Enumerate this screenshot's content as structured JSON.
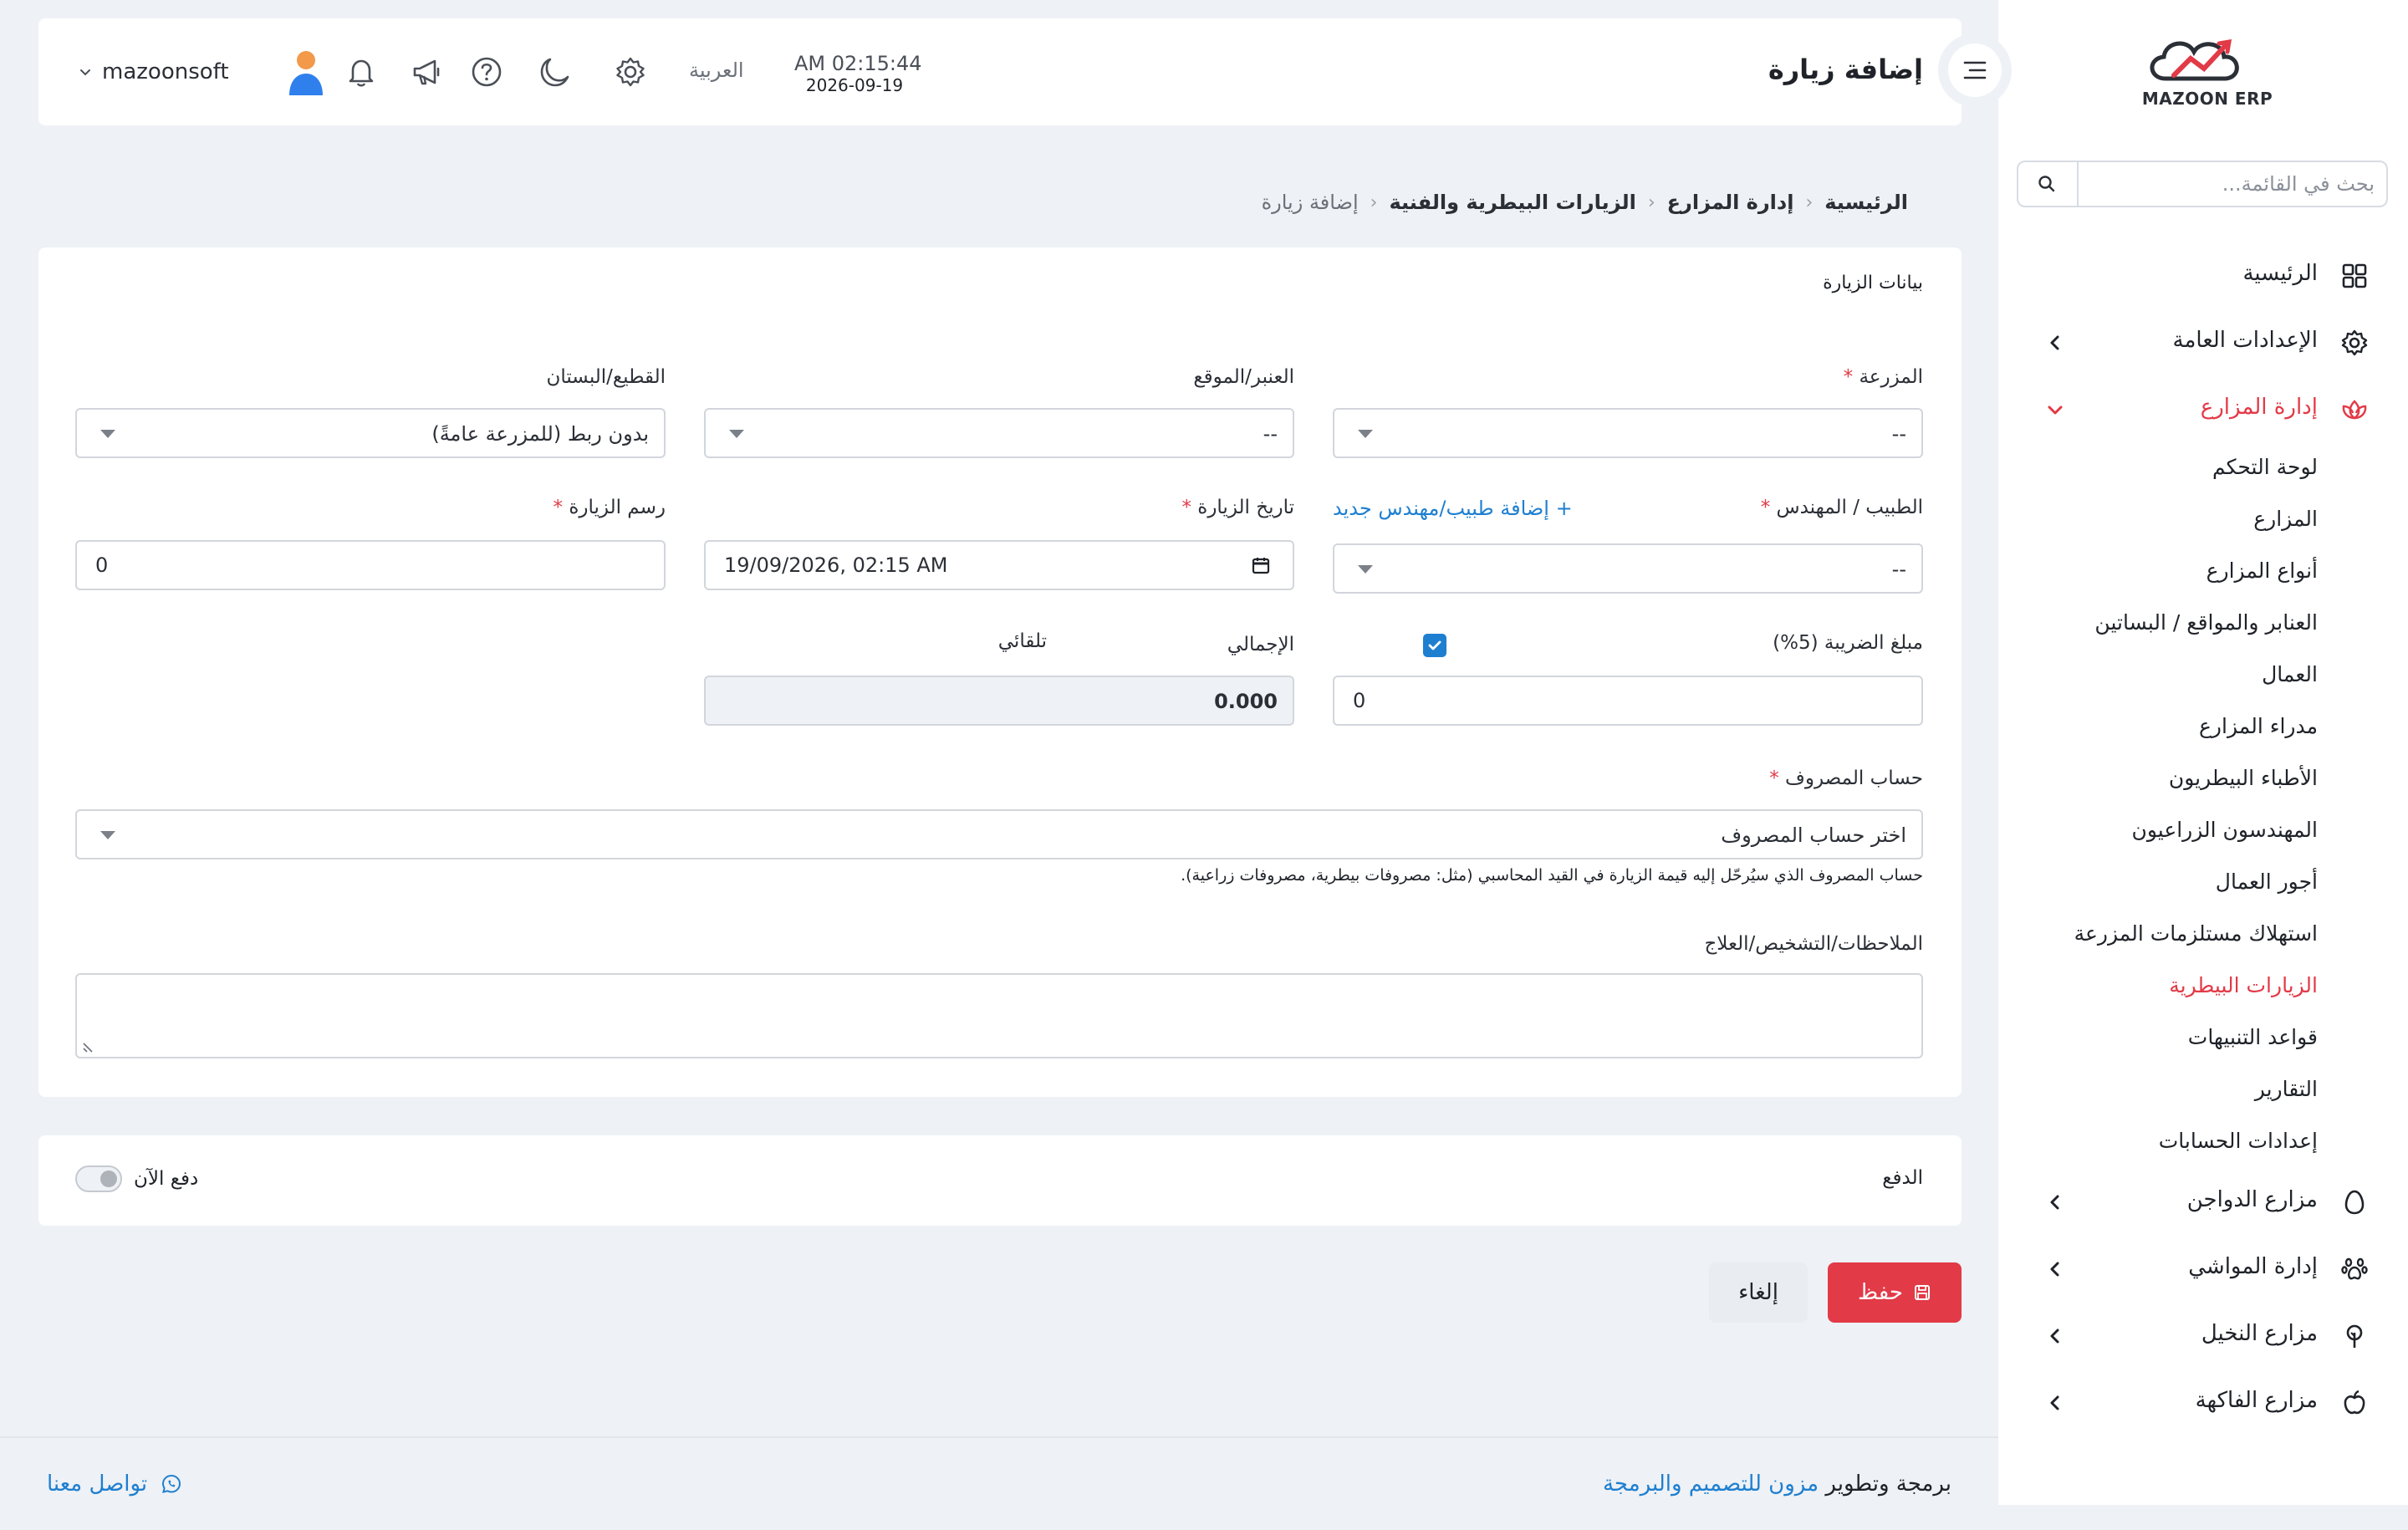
{
  "brand": {
    "logo_text": "MAZOON ERP",
    "accent": "#e23a47",
    "link_color": "#1e7fd0"
  },
  "sidebar": {
    "search_placeholder": "بحث في القائمة...",
    "items": [
      {
        "label": "الرئيسية",
        "icon": "grid-icon"
      },
      {
        "label": "الإعدادات العامة",
        "icon": "gear-icon"
      },
      {
        "label": "إدارة المزارع",
        "icon": "lotus-icon"
      },
      {
        "label": "مزارع الدواجن",
        "icon": "egg-icon"
      },
      {
        "label": "إدارة المواشي",
        "icon": "paw-icon"
      },
      {
        "label": "مزارع النخيل",
        "icon": "tree-icon"
      },
      {
        "label": "مزارع الفاكهة",
        "icon": "apple-icon"
      }
    ],
    "sub_items": [
      "لوحة التحكم",
      "المزارع",
      "أنواع المزارع",
      "العنابر والمواقع / البساتين",
      "العمال",
      "مدراء المزارع",
      "الأطباء البيطريون",
      "المهندسون الزراعيون",
      "أجور العمال",
      "استهلاك مستلزمات المزرعة",
      "الزيارات البيطرية",
      "قواعد التنبيهات",
      "التقارير",
      "إعدادات الحسابات"
    ]
  },
  "header": {
    "title": "إضافة زيارة",
    "time": "AM 02:15:44",
    "date": "2026-09-19",
    "language": "العربية",
    "username": "mazoonsoft"
  },
  "breadcrumb": [
    "الرئيسية",
    "إدارة المزارع",
    "الزيارات البيطرية والفنية",
    "إضافة زيارة"
  ],
  "form": {
    "section_title": "بيانات الزيارة",
    "farm": {
      "label": "المزرعة",
      "value": "--"
    },
    "site": {
      "label": "العنبر/الموقع",
      "value": "--"
    },
    "plot": {
      "label": "القطيع/البستان",
      "value": "بدون ربط (للمزرعة عامةً)"
    },
    "vet": {
      "label": "الطبيب / المهندس",
      "value": "--",
      "add_link": "+ إضافة طبيب/مهندس جديد"
    },
    "visit_date": {
      "label": "تاريخ الزيارة",
      "value": "19/09/2026, 02:15 AM"
    },
    "visit_fee": {
      "label": "رسم الزيارة",
      "value": "0"
    },
    "tax": {
      "label": "مبلغ الضريبة (5%)",
      "value": "0",
      "auto_label": "تلقائي"
    },
    "total": {
      "label": "الإجمالي",
      "value": "0.000"
    },
    "expense_account": {
      "label": "حساب المصروف",
      "value": "اختر حساب المصروف",
      "hint": "حساب المصروف الذي سيُرحّل إليه قيمة الزيارة في القيد المحاسبي (مثل: مصروفات بيطرية، مصروفات زراعية)."
    },
    "notes": {
      "label": "الملاحظات/التشخيص/العلاج",
      "value": ""
    }
  },
  "payment": {
    "title": "الدفع",
    "toggle_label": "دفع الآن"
  },
  "actions": {
    "save": "حفظ",
    "cancel": "إلغاء"
  },
  "footer": {
    "credit_prefix": "برمجة وتطوير",
    "credit_link": "مزون للتصميم والبرمجة",
    "contact": "تواصل معنا"
  }
}
